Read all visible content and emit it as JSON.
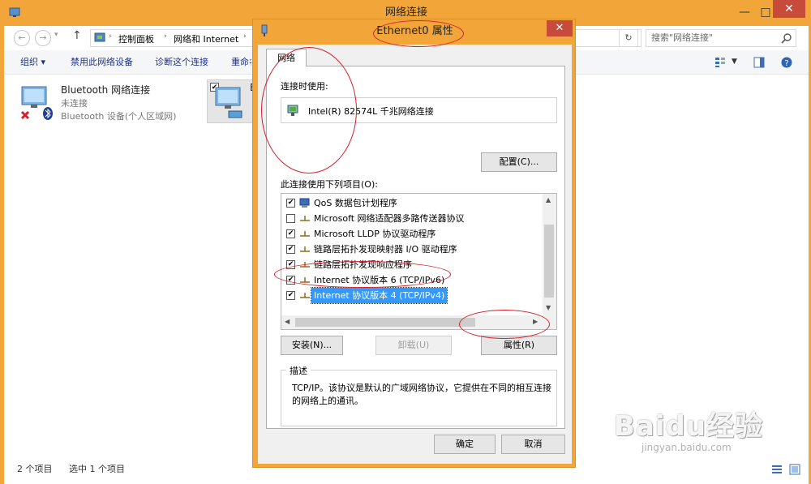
{
  "explorer": {
    "title": "网络连接",
    "window_controls": {
      "minimize": "—",
      "maximize": "□",
      "close": "✕"
    },
    "nav": {
      "back": "←",
      "forward": "→",
      "recent": "▾",
      "up": "↑"
    },
    "breadcrumb": [
      "控制面板",
      "网络和 Internet"
    ],
    "breadcrumb_sep": "›",
    "refresh": "↻",
    "search_placeholder": "搜索\"网络连接\"",
    "commands": [
      "组织 ▾",
      "禁用此网络设备",
      "诊断这个连接",
      "重命名"
    ],
    "connections": [
      {
        "name": "Bluetooth 网络连接",
        "status": "未连接",
        "device": "Bluetooth 设备(个人区域网)"
      },
      {
        "name": "E"
      }
    ],
    "status_left": "2 个项目",
    "status_selected": "选中 1 个项目"
  },
  "dialog": {
    "title": "Ethernet0 属性",
    "close": "✕",
    "tab": "网络",
    "connect_using_label": "连接时使用:",
    "adapter": "Intel(R) 82574L 千兆网络连接",
    "configure_button": "配置(C)...",
    "items_label": "此连接使用下列项目(O):",
    "items": [
      {
        "label": "QoS 数据包计划程序",
        "checked": true
      },
      {
        "label": "Microsoft 网络适配器多路传送器协议",
        "checked": false
      },
      {
        "label": "Microsoft LLDP 协议驱动程序",
        "checked": true
      },
      {
        "label": "链路层拓扑发现映射器 I/O 驱动程序",
        "checked": true
      },
      {
        "label": "链路层拓扑发现响应程序",
        "checked": true
      },
      {
        "label": "Internet 协议版本 6 (TCP/IPv6)",
        "checked": true
      },
      {
        "label": "Internet 协议版本 4 (TCP/IPv4)",
        "checked": true,
        "selected": true
      }
    ],
    "install_button": "安装(N)...",
    "uninstall_button": "卸载(U)",
    "properties_button": "属性(R)",
    "description_legend": "描述",
    "description_text": "TCP/IP。该协议是默认的广域网络协议，它提供在不同的相互连接的网络上的通讯。",
    "ok_button": "确定",
    "cancel_button": "取消"
  },
  "watermark": {
    "logo": "Baidu经验",
    "url": "jingyan.baidu.com"
  },
  "colors": {
    "accent": "#f2a63a",
    "selection": "#3399ff",
    "annotation": "#d3202a",
    "link": "#1e3287"
  }
}
